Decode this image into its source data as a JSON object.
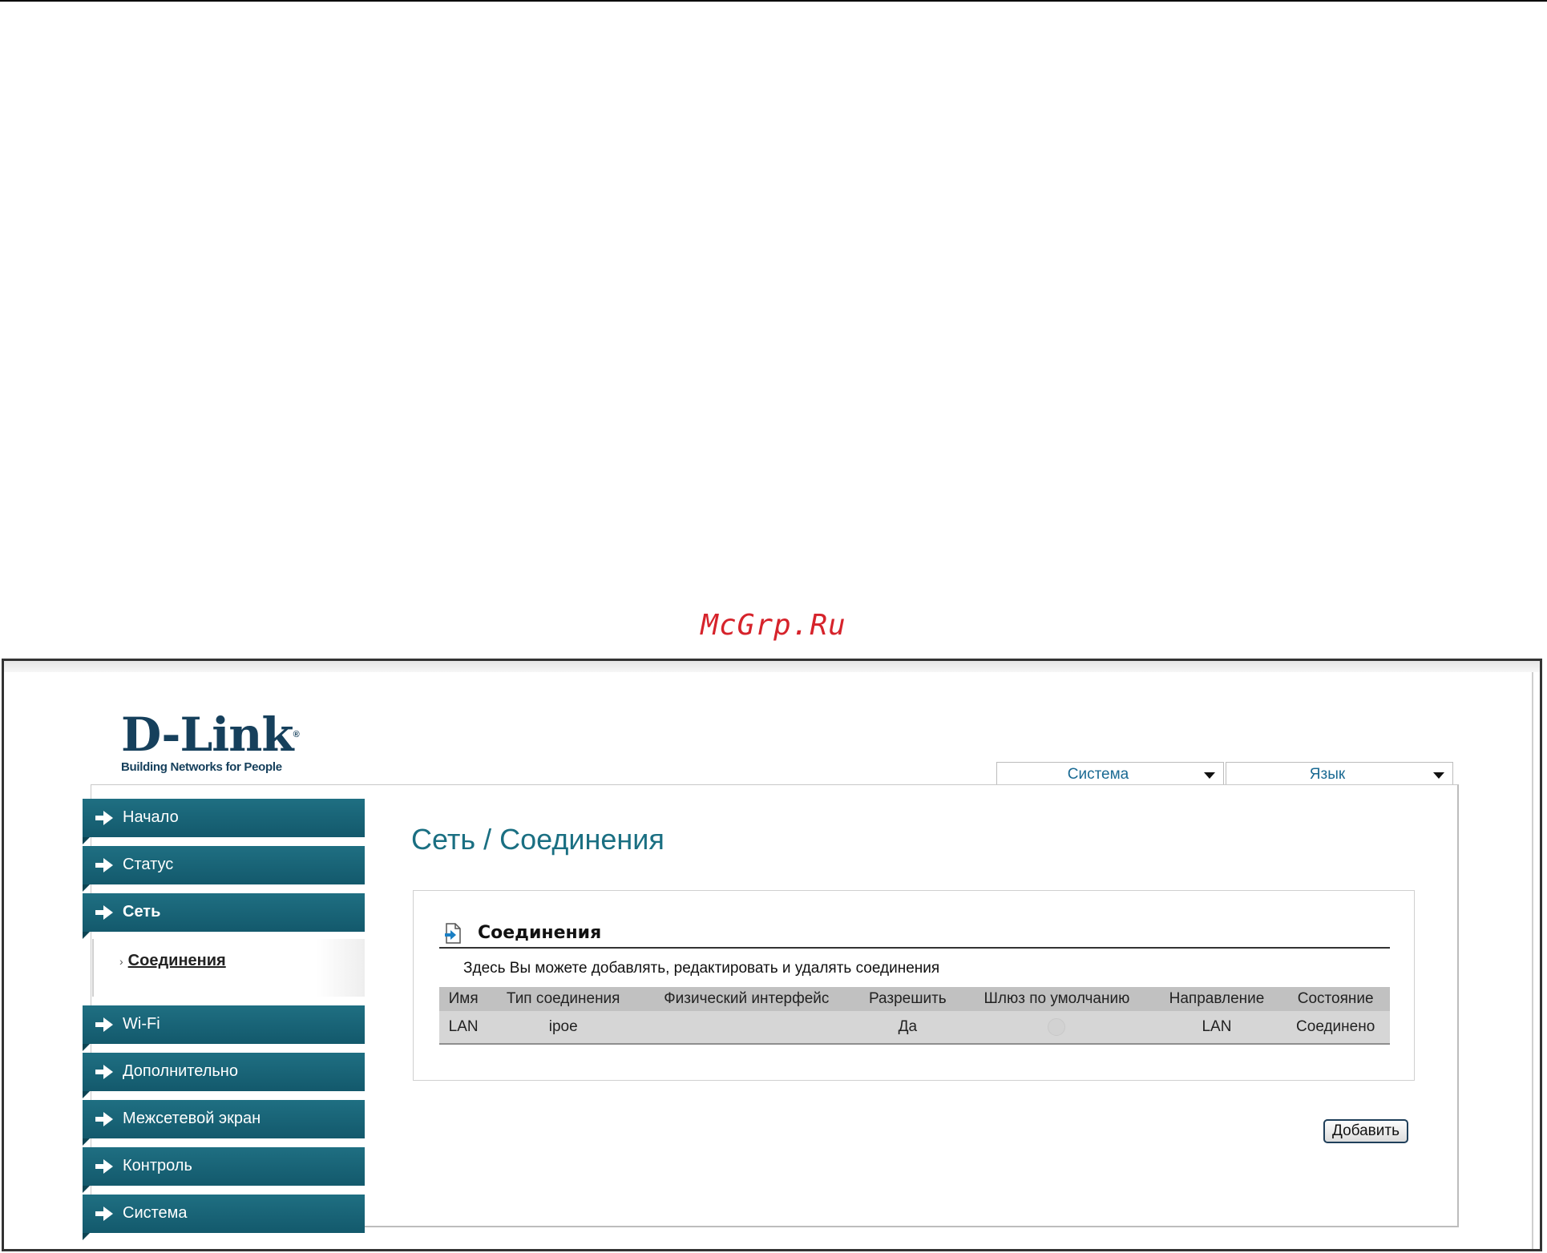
{
  "watermark": "McGrp.Ru",
  "logo": {
    "brand": "D-Link",
    "tagline": "Building Networks for People"
  },
  "dropdowns": {
    "system": "Система",
    "language": "Язык"
  },
  "sidebar": {
    "items": [
      {
        "label": "Начало"
      },
      {
        "label": "Статус"
      },
      {
        "label": "Сеть"
      },
      {
        "label": "Wi-Fi"
      },
      {
        "label": "Дополнительно"
      },
      {
        "label": "Межсетевой экран"
      },
      {
        "label": "Контроль"
      },
      {
        "label": "Система"
      }
    ],
    "subitem": {
      "label": "Соединения"
    }
  },
  "page": {
    "title": "Сеть / Соединения"
  },
  "panel": {
    "title": "Соединения",
    "description": "Здесь Вы можете добавлять, редактировать и удалять соединения"
  },
  "table": {
    "headers": [
      "Имя",
      "Тип соединения",
      "Физический интерфейс",
      "Разрешить",
      "Шлюз по умолчанию",
      "Направление",
      "Состояние"
    ],
    "rows": [
      {
        "name": "LAN",
        "type": "ipoe",
        "iface": "",
        "enabled": "Да",
        "gateway": "",
        "direction": "LAN",
        "state": "Соединено"
      }
    ]
  },
  "buttons": {
    "add": "Добавить"
  },
  "colors": {
    "nav": "#1f6f82",
    "title": "#1a6f82",
    "brand": "#16405c",
    "watermark": "#d6232b"
  },
  "icons": {
    "nav": "arrow-right-icon",
    "panel": "document-arrow-icon",
    "dropdown": "chevron-down-icon"
  }
}
